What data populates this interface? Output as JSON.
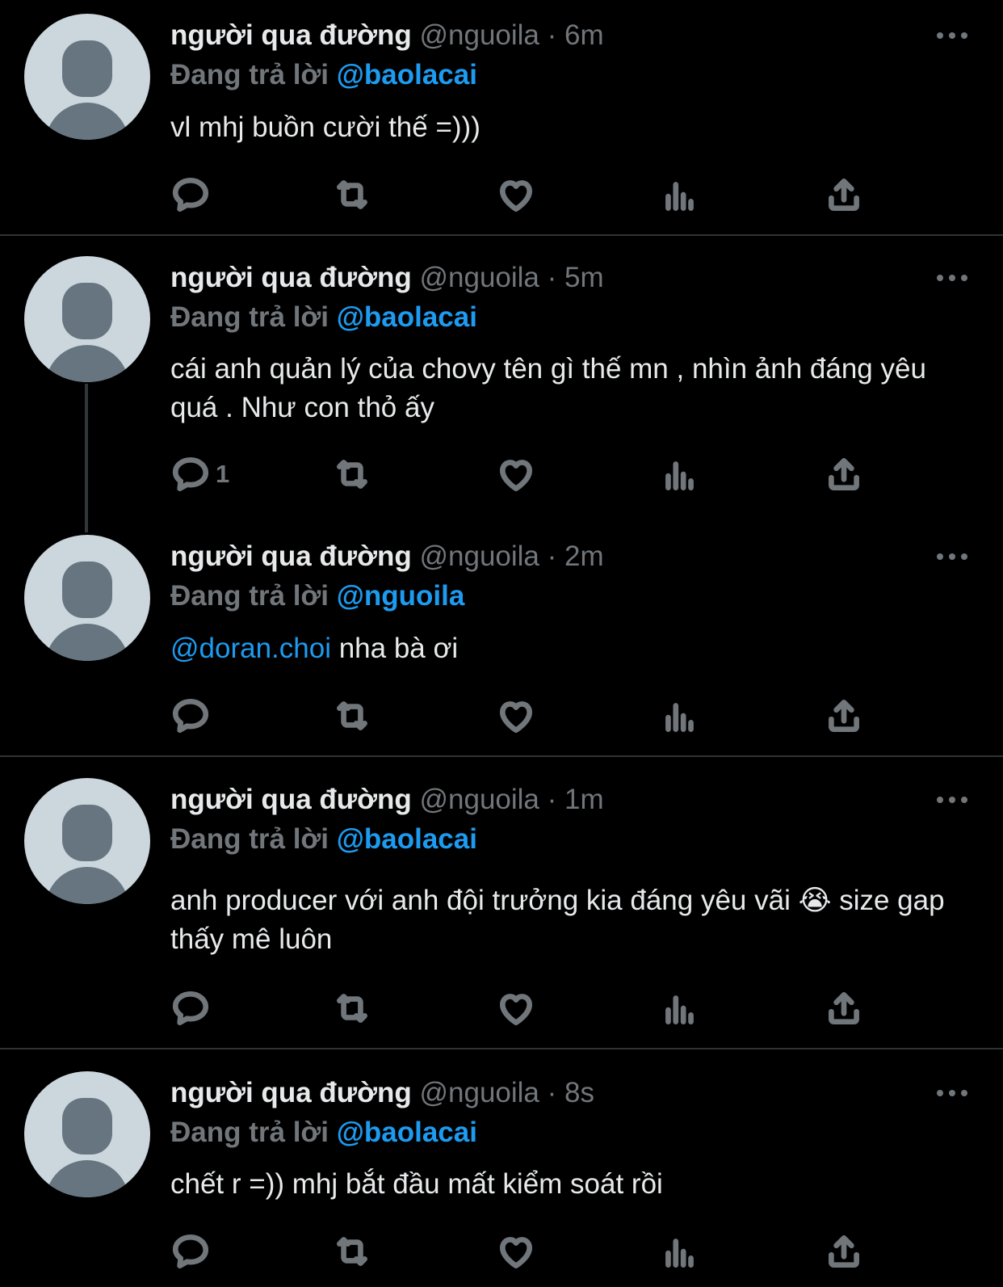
{
  "colors": {
    "background": "#000000",
    "text": "#e7e9ea",
    "muted": "#71767b",
    "link": "#1d9bf0",
    "divider": "#2f3336",
    "avatar_bg": "#ccd6dd",
    "avatar_fg": "#66757f"
  },
  "reply_prefix": "Đang trả lời",
  "tweets": [
    {
      "name": "người qua đường",
      "handle": "@nguoila",
      "separator": "·",
      "time": "6m",
      "reply_to": "@baolacai",
      "mention": "",
      "text": "vl mhj buồn cười thế =)))",
      "reply_count": ""
    },
    {
      "name": "người qua đường",
      "handle": "@nguoila",
      "separator": "·",
      "time": "5m",
      "reply_to": "@baolacai",
      "mention": "",
      "text": "cái anh quản lý của chovy tên gì thế mn , nhìn ảnh đáng yêu quá . Như con thỏ ấy",
      "reply_count": "1"
    },
    {
      "name": "người qua đường",
      "handle": "@nguoila",
      "separator": "·",
      "time": "2m",
      "reply_to": "@nguoila",
      "mention": "@doran.choi",
      "text": " nha bà ơi",
      "reply_count": ""
    },
    {
      "name": "người qua đường",
      "handle": "@nguoila",
      "separator": "·",
      "time": "1m",
      "reply_to": "@baolacai",
      "mention": "",
      "text": "anh producer với anh đội trưởng kia đáng yêu vãi 😭 size gap thấy mê luôn",
      "reply_count": ""
    },
    {
      "name": "người qua đường",
      "handle": "@nguoila",
      "separator": "·",
      "time": "8s",
      "reply_to": "@baolacai",
      "mention": "",
      "text": "chết r =)) mhj bắt đầu mất kiểm soát rồi",
      "reply_count": ""
    }
  ],
  "icons": {
    "reply": "reply-icon",
    "retweet": "retweet-icon",
    "like": "like-icon",
    "views": "views-icon",
    "share": "share-icon",
    "more": "more-icon"
  }
}
